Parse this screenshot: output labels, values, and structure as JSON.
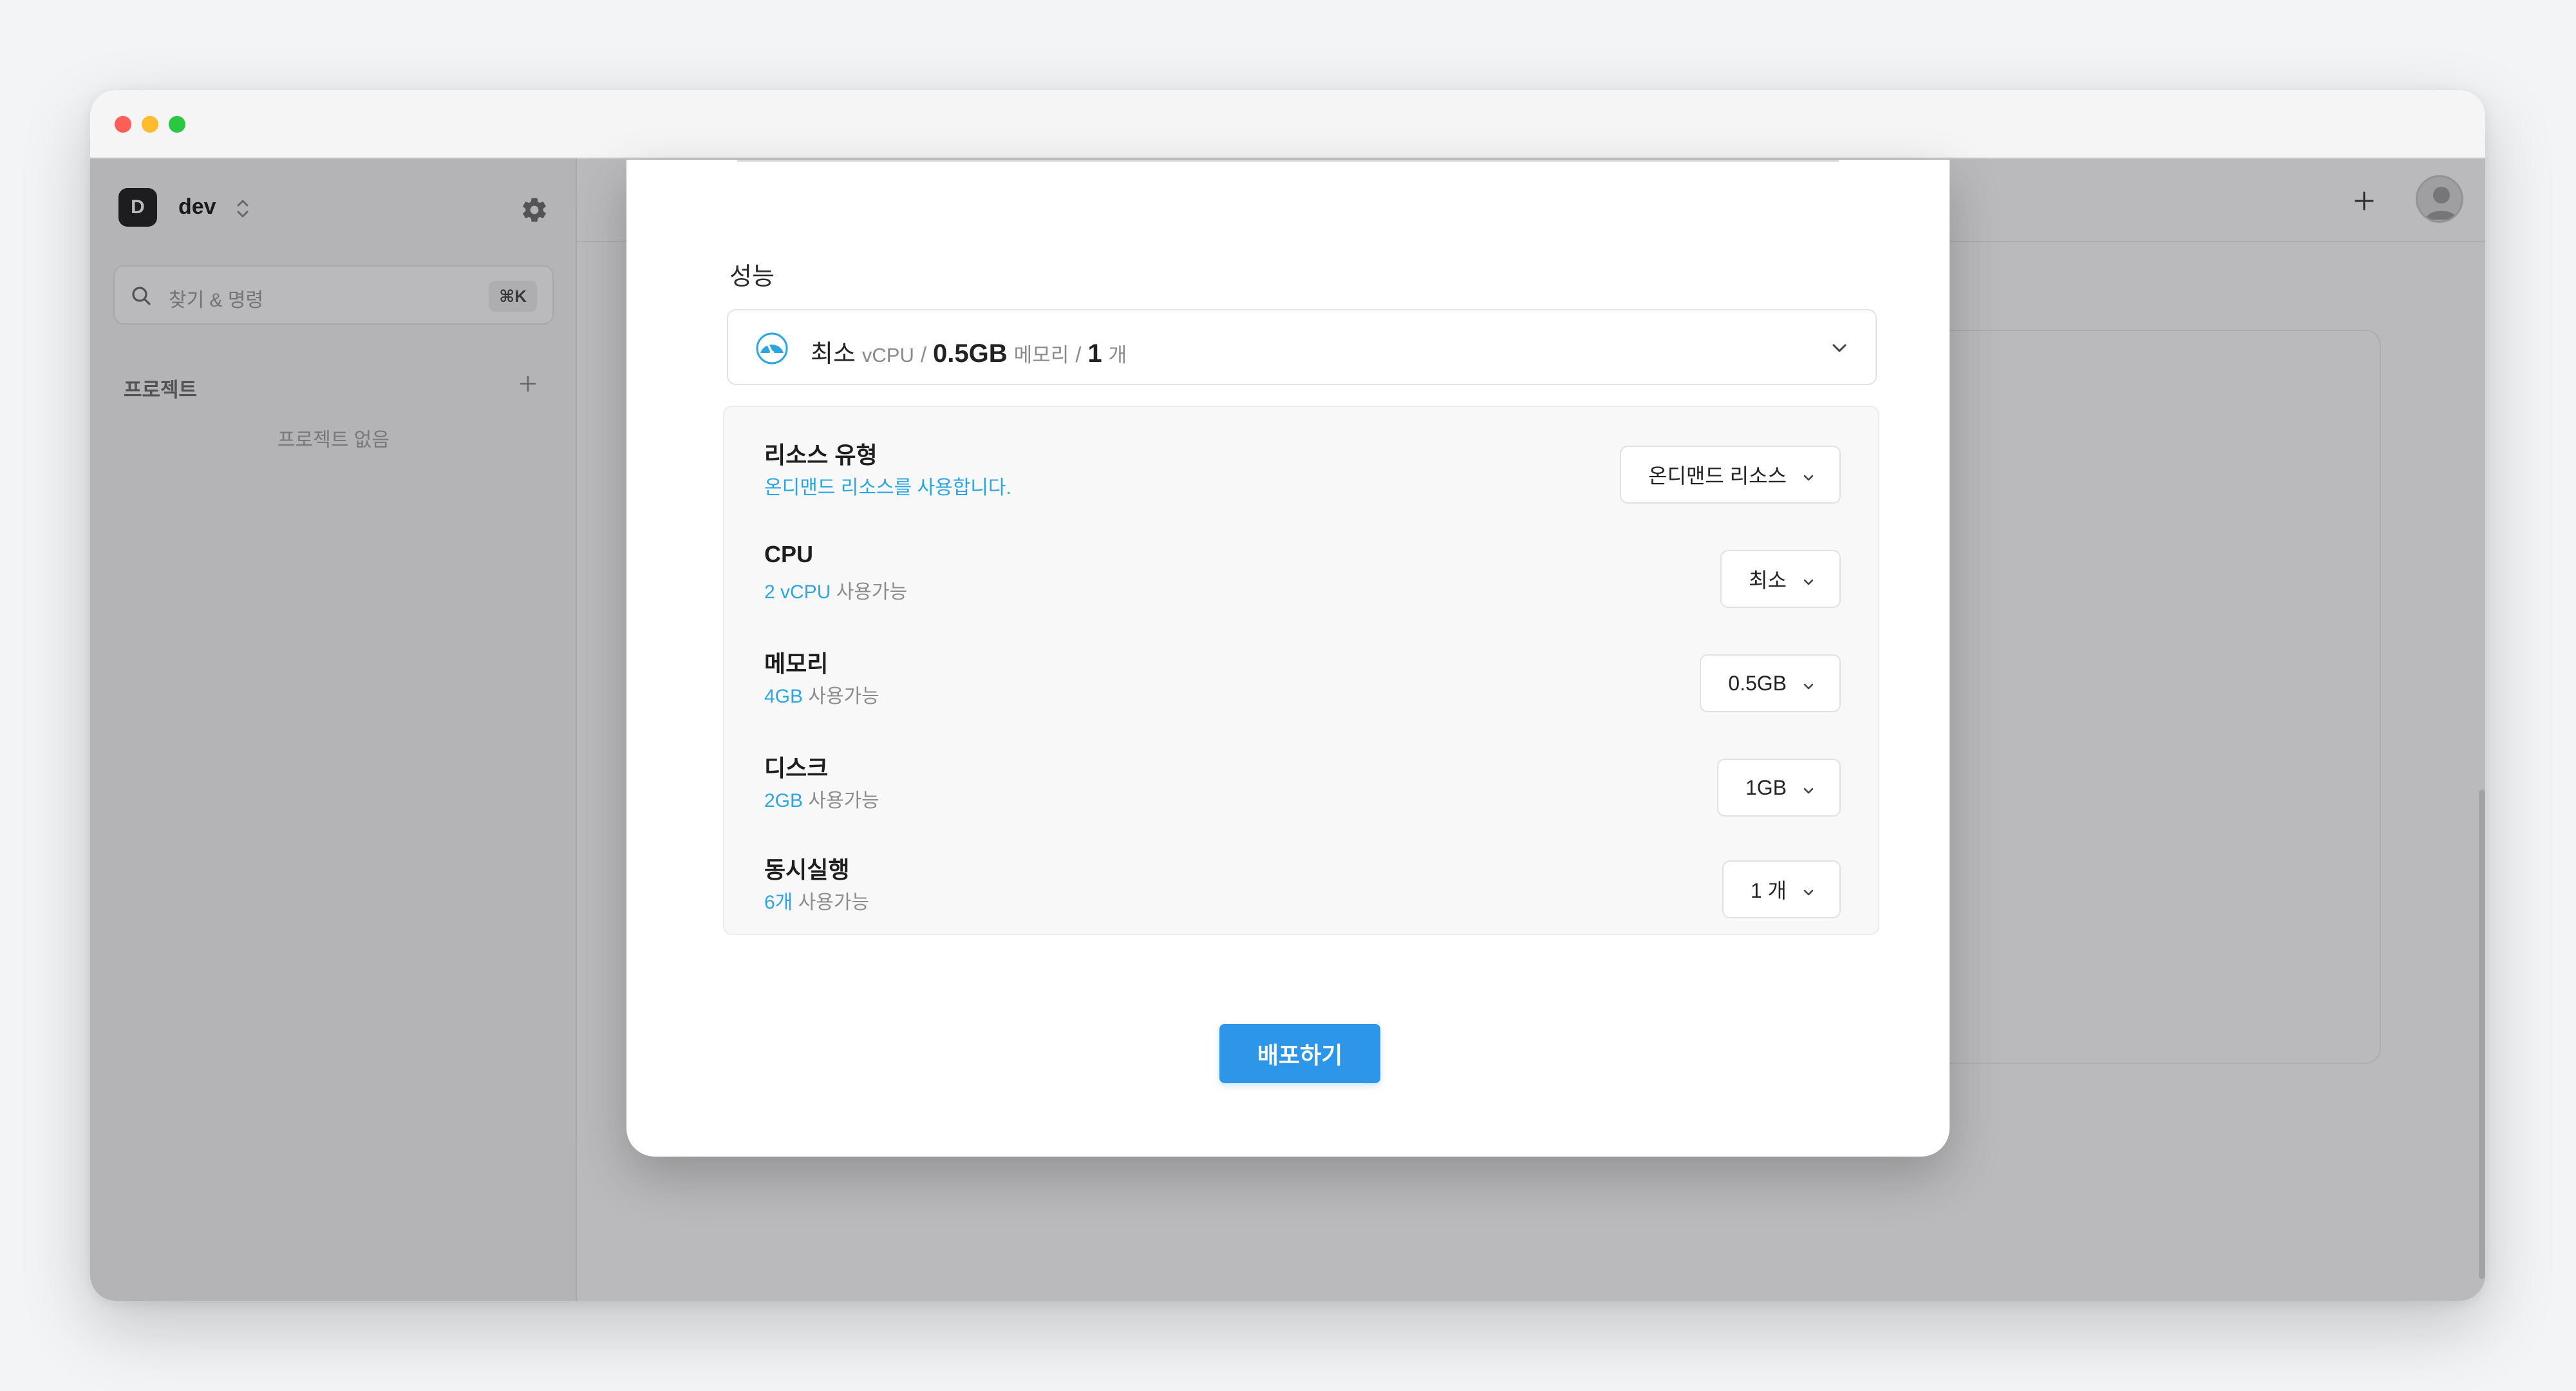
{
  "window": {
    "traffic_lights": [
      "close",
      "minimize",
      "zoom"
    ]
  },
  "sidebar": {
    "workspace_initial": "D",
    "workspace_name": "dev",
    "search_placeholder": "찾기 & 명령",
    "search_shortcut": "⌘K",
    "projects_title": "프로젝트",
    "projects_empty": "프로젝트 없음"
  },
  "header": {
    "add_icon": "plus-icon",
    "avatar_icon": "user-avatar"
  },
  "modal": {
    "performance_label": "성능",
    "summary": {
      "cpu_value": "최소",
      "cpu_unit": "vCPU",
      "slash": "/",
      "memory_value": "0.5GB",
      "memory_unit": "메모리",
      "count_value": "1",
      "count_unit": "개"
    },
    "rows": [
      {
        "title": "리소스 유형",
        "desc_accent": "온디맨드 리소스를 사용합니다.",
        "desc_muted": "",
        "value": "온디맨드 리소스"
      },
      {
        "title": "CPU",
        "desc_accent": "2 vCPU",
        "desc_muted": "사용가능",
        "value": "최소"
      },
      {
        "title": "메모리",
        "desc_accent": "4GB",
        "desc_muted": "사용가능",
        "value": "0.5GB"
      },
      {
        "title": "디스크",
        "desc_accent": "2GB",
        "desc_muted": "사용가능",
        "value": "1GB"
      },
      {
        "title": "동시실행",
        "desc_accent": "6개",
        "desc_muted": "사용가능",
        "value": "1 개"
      }
    ],
    "deploy_label": "배포하기"
  },
  "colors": {
    "accent": "#2ba6e2",
    "primary_button": "#2e96e8",
    "overlay": "rgba(28,28,32,0.30)"
  }
}
